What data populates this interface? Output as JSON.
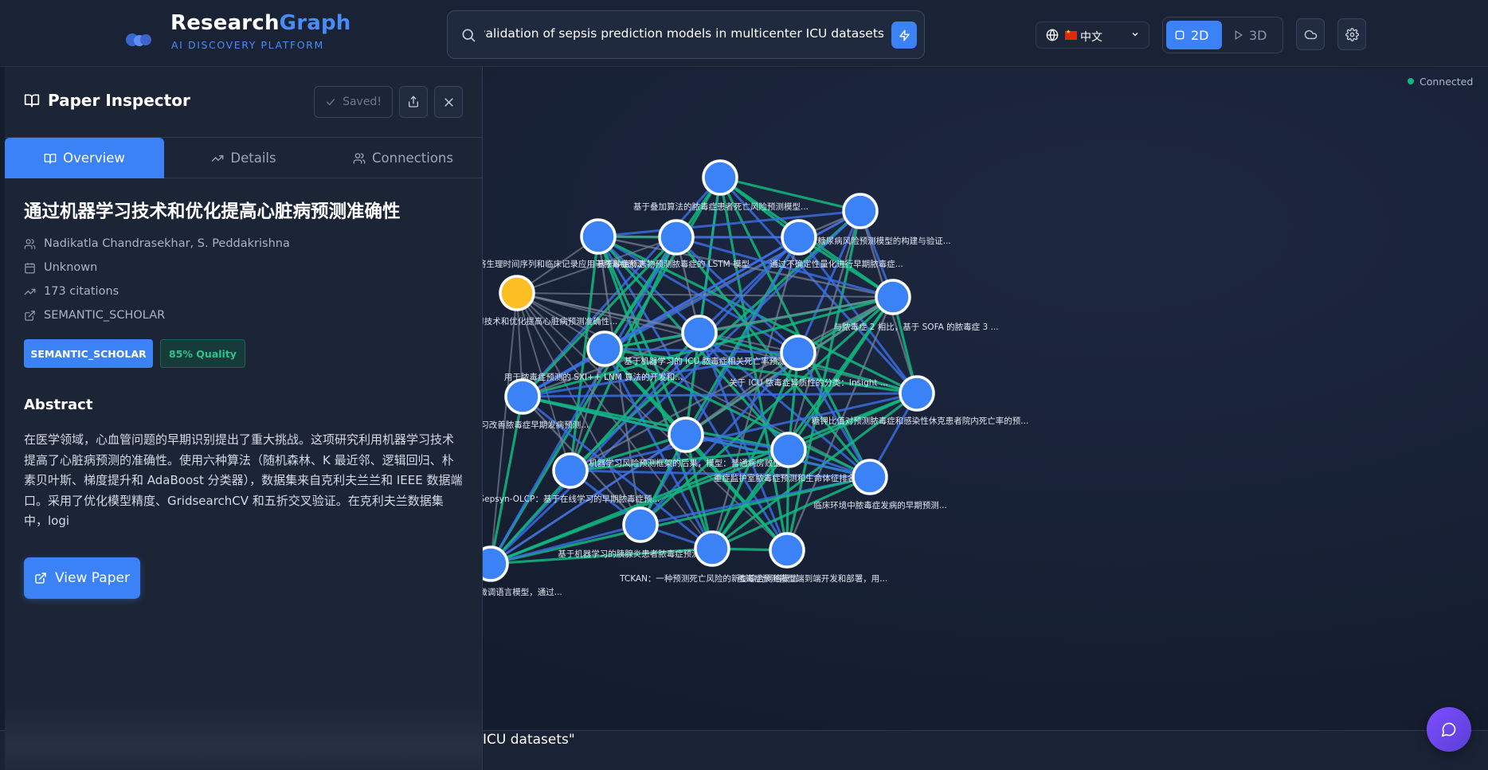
{
  "app": {
    "brand_main": "Research",
    "brand_accent": "Graph",
    "brand_sub": "AI DISCOVERY PLATFORM"
  },
  "search": {
    "value": "External validation of sepsis prediction models in multicenter ICU datasets"
  },
  "language": {
    "label": "中文"
  },
  "view_toggle": {
    "mode_2d": "2D",
    "mode_3d": "3D",
    "active": "2D"
  },
  "status": {
    "label": "Connected"
  },
  "bottom": {
    "text": "ICU datasets\""
  },
  "inspector": {
    "title": "Paper Inspector",
    "saved_label": "Saved!",
    "tabs": [
      {
        "label": "Overview",
        "icon": "book-open-icon",
        "active": true
      },
      {
        "label": "Details",
        "icon": "trending-up-icon",
        "active": false
      },
      {
        "label": "Connections",
        "icon": "users-icon",
        "active": false
      }
    ],
    "paper": {
      "title": "通过机器学习技术和优化提高心脏病预测准确性",
      "authors": "Nadikatla Chandrasekhar, S. Peddakrishna",
      "date": "Unknown",
      "citations": "173 citations",
      "source": "SEMANTIC_SCHOLAR",
      "badge_source": "SEMANTIC_SCHOLAR",
      "badge_quality": "85% Quality",
      "abstract_heading": "Abstract",
      "abstract_lines": [
        "在医学领域，心血管问题的早期识别提出了重大挑战。这项研究利用机器学习技术",
        "提高了心脏病预测的准确性。使用六种算法（随机森林、K 最近邻、逻辑回归、朴",
        "素贝叶斯、梯度提升和 AdaBoost 分类器），数据集来自克利夫兰兰和 IEEE 数据端",
        "口。采用了优化模型精度、GridsearchCV 和五折交叉验证。在克利夫兰数据集",
        "中，logi"
      ],
      "view_paper_label": "View Paper"
    }
  },
  "graph": {
    "colors": {
      "node": "#3b82f6",
      "selected_node": "#fbbf24",
      "edge_green": "#10b981",
      "edge_blue": "#3b6fe6",
      "edge_gray": "#7b8599"
    },
    "nodes": [
      {
        "label": "基于叠加算法的脓毒症患者死亡风险预测模型..."
      },
      {
        "label": "糖尿病风险预测模型的构建与验证..."
      },
      {
        "label": "将生理时间序列和临床记录应用于脓毒症预测"
      },
      {
        "label": "基于肿瘤标志物预测脓毒症的 LSTM 模型"
      },
      {
        "label": "通过不确定性量化进行早期脓毒症..."
      },
      {
        "label": "通过机器学习技术和优化提高心脏病预测准确性..."
      },
      {
        "label": "与脓毒症 2 相比，基于 SOFA 的脓毒症 3 ..."
      },
      {
        "label": "基于机器学习的 ICU 脓毒症相关死亡率预测"
      },
      {
        "label": "用于脓毒症预测的 SXI++ LNM 算法的开发和..."
      },
      {
        "label": "关于 ICU 脓毒症异质性的分类：Insight ..."
      },
      {
        "label": "通过机器学习改善脓毒症早期发病预测..."
      },
      {
        "label": "糖钾比值对预测脓毒症和感染性休克患者院内死亡率的预..."
      },
      {
        "label": "机器学习风险预测框架的后果，模型：普通病房败血..."
      },
      {
        "label": "重症监护室脓毒症预测和生命体征排名"
      },
      {
        "label": "Sepsyn-OLCP：基于在线学习的早期脓毒症预..."
      },
      {
        "label": "临床环境中脓毒症发病的早期预测..."
      },
      {
        "label": "基于机器学习的胰腺炎患者脓毒症预测模型"
      },
      {
        "label": "指令微调语言模型，通过..."
      },
      {
        "label": "TCKAN：一种预测死亡风险的新型综合网络模型"
      },
      {
        "label": "脓毒症预测模型端到端开发和部署，用..."
      }
    ]
  }
}
